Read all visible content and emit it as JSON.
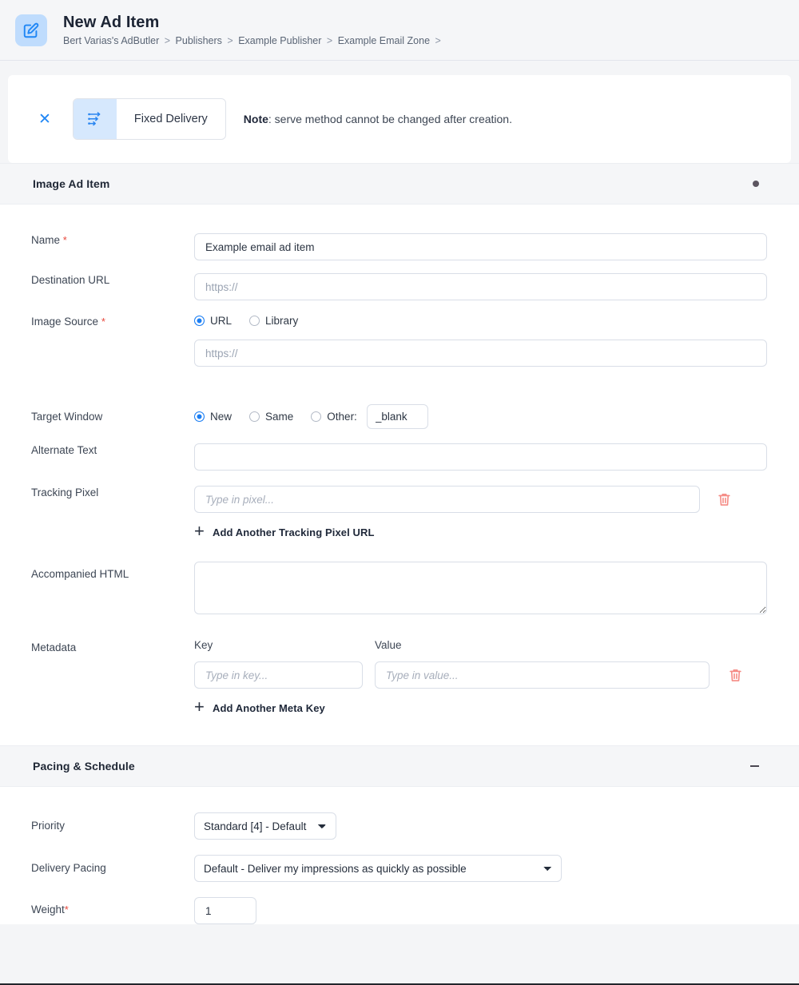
{
  "header": {
    "icon": "edit-square-icon",
    "title": "New Ad Item",
    "breadcrumb": [
      "Bert Varias's AdButler",
      "Publishers",
      "Example Publisher",
      "Example Email Zone"
    ],
    "breadcrumb_separator": ">"
  },
  "serve_method": {
    "close_icon": "close-icon",
    "chip_icon": "fixed-delivery-arrows-icon",
    "chip_label": "Fixed Delivery",
    "note_bold": "Note",
    "note_text": ": serve method cannot be changed after creation."
  },
  "sections": {
    "image_ad_item": {
      "title": "Image Ad Item",
      "toggle_icon": "collapse-dot-icon"
    },
    "pacing_schedule": {
      "title": "Pacing & Schedule",
      "toggle_icon": "collapse-minus-icon"
    }
  },
  "fields": {
    "name": {
      "label": "Name",
      "required_marker": "*",
      "value": "Example email ad item",
      "placeholder": ""
    },
    "destination_url": {
      "label": "Destination URL",
      "value": "",
      "placeholder": "https://"
    },
    "image_source": {
      "label": "Image Source",
      "required_marker": "*",
      "options": [
        {
          "label": "URL",
          "selected": true
        },
        {
          "label": "Library",
          "selected": false
        }
      ],
      "url_value": "",
      "url_placeholder": "https://"
    },
    "target_window": {
      "label": "Target Window",
      "options": [
        {
          "label": "New",
          "selected": true
        },
        {
          "label": "Same",
          "selected": false
        },
        {
          "label": "Other:",
          "selected": false
        }
      ],
      "other_value": "_blank",
      "other_placeholder": ""
    },
    "alternate_text": {
      "label": "Alternate Text",
      "value": "",
      "placeholder": ""
    },
    "tracking_pixel": {
      "label": "Tracking Pixel",
      "value": "",
      "placeholder": "Type in pixel...",
      "delete_icon": "trash-icon",
      "add_label": "Add Another Tracking Pixel URL",
      "add_icon": "plus-icon"
    },
    "accompanied_html": {
      "label": "Accompanied HTML",
      "value": "",
      "placeholder": ""
    },
    "metadata": {
      "label": "Metadata",
      "key_header": "Key",
      "value_header": "Value",
      "key_value": "",
      "key_placeholder": "Type in key...",
      "value_value": "",
      "value_placeholder": "Type in value...",
      "delete_icon": "trash-icon",
      "add_label": "Add Another Meta Key",
      "add_icon": "plus-icon"
    },
    "priority": {
      "label": "Priority",
      "selected": "Standard [4] - Default",
      "options": [
        "Standard [4] - Default"
      ]
    },
    "delivery_pacing": {
      "label": "Delivery Pacing",
      "selected": "Default - Deliver my impressions as quickly as possible",
      "options": [
        "Default - Deliver my impressions as quickly as possible"
      ]
    },
    "weight": {
      "label": "Weight",
      "required_marker": "*",
      "value": "1",
      "placeholder": ""
    }
  },
  "colors": {
    "accent_blue": "#1b7ef3",
    "icon_bg_blue": "#bfdcfd",
    "chip_icon_bg": "#d6e8fd",
    "required_red": "#e8483c",
    "trash_red": "#f58a84",
    "band_gray": "#f5f6f8"
  }
}
